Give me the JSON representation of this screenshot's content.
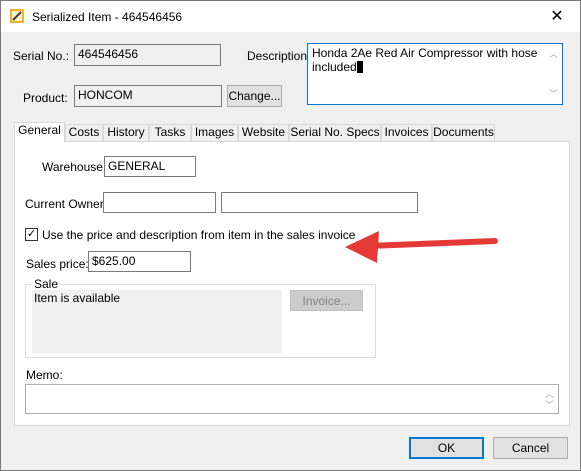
{
  "window": {
    "title": "Serialized Item - 464546456",
    "close_glyph": "✕"
  },
  "form": {
    "serial_label": "Serial No.:",
    "serial_value": "464546456",
    "product_label": "Product:",
    "product_value": "HONCOM",
    "change_button": "Change...",
    "description_label": "Description:",
    "description_value": "Honda 2Ae Red  Air Compressor with hose included"
  },
  "tabs": [
    {
      "label": "General",
      "active": true
    },
    {
      "label": "Costs"
    },
    {
      "label": "History"
    },
    {
      "label": "Tasks"
    },
    {
      "label": "Images"
    },
    {
      "label": "Website"
    },
    {
      "label": "Serial No. Specs"
    },
    {
      "label": "Invoices"
    },
    {
      "label": "Documents"
    }
  ],
  "general": {
    "warehouse_label": "Warehouse:",
    "warehouse_value": "GENERAL",
    "owner_label": "Current Owner:",
    "owner_value_1": "",
    "owner_value_2": "",
    "use_price_checkbox_label": "Use the price and description from item in the sales invoice",
    "use_price_checked": true,
    "sales_price_label": "Sales price:",
    "sales_price_value": "$625.00",
    "sale_group_label": "Sale",
    "sale_status": "Item is available",
    "invoice_button": "Invoice...",
    "memo_label": "Memo:",
    "memo_value": ""
  },
  "buttons": {
    "ok": "OK",
    "cancel": "Cancel"
  },
  "colors": {
    "accent_border": "#0078d7",
    "annotation_arrow": "#e53935"
  },
  "icons": {
    "app": "app-pencil-icon",
    "close": "close-icon",
    "check": "checkmark-icon",
    "scroll_up": "scroll-up-icon",
    "scroll_down": "scroll-down-icon",
    "annotation": "red-arrow-annotation"
  }
}
